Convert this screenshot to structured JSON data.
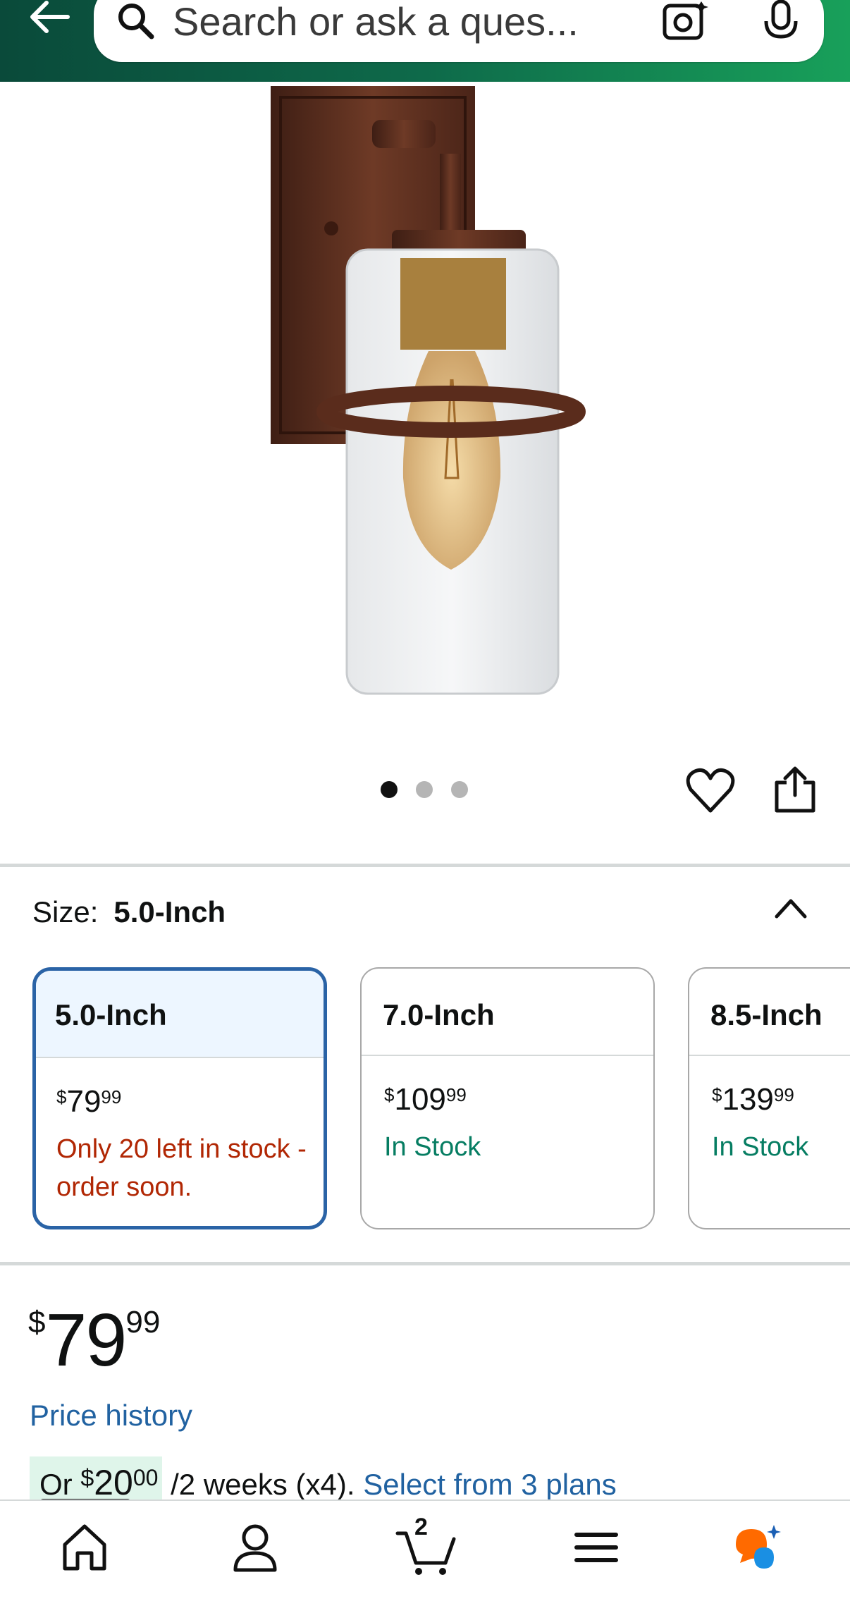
{
  "header": {
    "search_placeholder": "Search or ask a ques...",
    "icons": [
      "back-arrow-icon",
      "search-icon",
      "camera-icon",
      "microphone-icon"
    ]
  },
  "gallery": {
    "image_count": 3,
    "active_index": 0,
    "icons": [
      "heart-icon",
      "share-icon"
    ]
  },
  "size": {
    "label": "Size:",
    "selected_value": "5.0-Inch",
    "options": [
      {
        "name": "5.0-Inch",
        "price_currency": "$",
        "price_whole": "79",
        "price_fraction": "99",
        "stock": "Only 20 left in stock - order soon.",
        "stock_status": "low",
        "selected": true
      },
      {
        "name": "7.0-Inch",
        "price_currency": "$",
        "price_whole": "109",
        "price_fraction": "99",
        "stock": "In Stock",
        "stock_status": "in",
        "selected": false
      },
      {
        "name": "8.5-Inch",
        "price_currency": "$",
        "price_whole": "139",
        "price_fraction": "99",
        "stock": "In Stock",
        "stock_status": "in",
        "selected": false
      }
    ]
  },
  "price": {
    "currency": "$",
    "whole": "79",
    "fraction": "99",
    "history_link": "Price history"
  },
  "payment_plan": {
    "prefix": "Or ",
    "currency": "$",
    "whole": "20",
    "fraction": "00",
    "period": " /2 weeks (x4). ",
    "link": "Select from 3 plans"
  },
  "bottom_nav": {
    "items": [
      "home-icon",
      "account-icon",
      "cart-icon",
      "menu-icon",
      "rufus-assistant-icon"
    ],
    "cart_count": "2"
  },
  "colors": {
    "header_start": "#0a4a3a",
    "header_end": "#18a05a",
    "selected_border": "#2a63a6",
    "link": "#2162a1",
    "stock_low": "#b12704",
    "stock_in": "#067d62"
  }
}
